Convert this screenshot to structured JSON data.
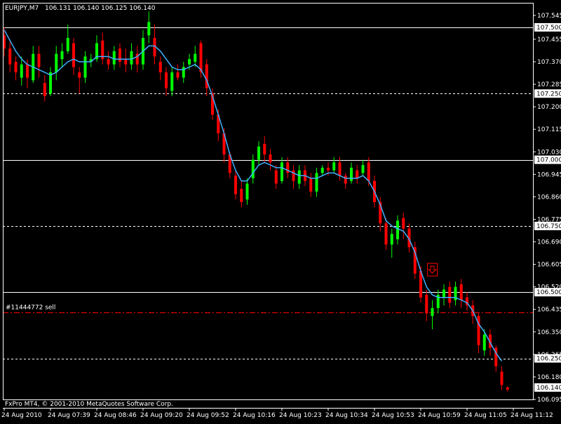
{
  "header": {
    "symbol": "EURJPY,M7",
    "quote": "106.131 106.140 106.125 106.140"
  },
  "footer": {
    "copyright": "FxPro MT4, © 2001-2010 MetaQuotes Software Corp."
  },
  "colors": {
    "background": "#000000",
    "frame": "#ffffff",
    "bull": "#00ff00",
    "bear": "#ff0000",
    "ma": "#3fb0ff",
    "order_line": "#ff0000",
    "text": "#ffffff",
    "bid_box": "#ffffff"
  },
  "chart_data": {
    "type": "candlestick",
    "ylim": [
      106.095,
      107.59
    ],
    "price_ticks": [
      {
        "v": 107.545,
        "label": "107.545"
      },
      {
        "v": 107.455,
        "label": "107.455"
      },
      {
        "v": 107.37,
        "label": "107.370"
      },
      {
        "v": 107.285,
        "label": "107.285"
      },
      {
        "v": 107.2,
        "label": "107.200"
      },
      {
        "v": 107.115,
        "label": "107.115"
      },
      {
        "v": 107.03,
        "label": "107.030"
      },
      {
        "v": 106.945,
        "label": "106.945"
      },
      {
        "v": 106.86,
        "label": "106.860"
      },
      {
        "v": 106.775,
        "label": "106.775"
      },
      {
        "v": 106.69,
        "label": "106.690"
      },
      {
        "v": 106.605,
        "label": "106.605"
      },
      {
        "v": 106.52,
        "label": "106.520"
      },
      {
        "v": 106.435,
        "label": "106.435"
      },
      {
        "v": 106.35,
        "label": "106.350"
      },
      {
        "v": 106.265,
        "label": "106.265"
      },
      {
        "v": 106.18,
        "label": "106.180"
      },
      {
        "v": 106.095,
        "label": "106.095"
      }
    ],
    "levels": [
      {
        "v": 107.5,
        "label": "107.500",
        "style": "solid"
      },
      {
        "v": 107.25,
        "label": "107.250",
        "style": "dashed"
      },
      {
        "v": 107.0,
        "label": "107.000",
        "style": "solid"
      },
      {
        "v": 106.75,
        "label": "106.750",
        "style": "dashed"
      },
      {
        "v": 106.5,
        "label": "106.500",
        "style": "solid"
      },
      {
        "v": 106.25,
        "label": "106.250",
        "style": "dashed"
      }
    ],
    "bid": {
      "v": 106.14,
      "label": "106.140"
    },
    "order": {
      "v": 106.425,
      "label": "#11444772 sell"
    },
    "sell_arrow": {
      "bar": 74,
      "v": 106.585
    },
    "time_labels": [
      {
        "bar": 0,
        "label": "24 Aug 2010"
      },
      {
        "bar": 8,
        "label": "24 Aug 07:39"
      },
      {
        "bar": 16,
        "label": "24 Aug 08:46"
      },
      {
        "bar": 24,
        "label": "24 Aug 09:20"
      },
      {
        "bar": 32,
        "label": "24 Aug 09:52"
      },
      {
        "bar": 40,
        "label": "24 Aug 10:16"
      },
      {
        "bar": 48,
        "label": "24 Aug 10:23"
      },
      {
        "bar": 56,
        "label": "24 Aug 10:34"
      },
      {
        "bar": 64,
        "label": "24 Aug 10:53"
      },
      {
        "bar": 72,
        "label": "24 Aug 10:59"
      },
      {
        "bar": 80,
        "label": "24 Aug 11:05"
      },
      {
        "bar": 88,
        "label": "24 Aug 11:12"
      }
    ],
    "candles": [
      [
        107.47,
        107.42,
        107.5,
        107.39
      ],
      [
        107.42,
        107.36,
        107.45,
        107.33
      ],
      [
        107.37,
        107.33,
        107.39,
        107.3
      ],
      [
        107.31,
        107.36,
        107.39,
        107.28
      ],
      [
        107.36,
        107.31,
        107.38,
        107.27
      ],
      [
        107.3,
        107.4,
        107.43,
        107.29
      ],
      [
        107.4,
        107.35,
        107.43,
        107.31
      ],
      [
        107.29,
        107.24,
        107.32,
        107.22
      ],
      [
        107.25,
        107.33,
        107.35,
        107.24
      ],
      [
        107.33,
        107.4,
        107.43,
        107.3
      ],
      [
        107.38,
        107.41,
        107.44,
        107.35
      ],
      [
        107.41,
        107.46,
        107.51,
        107.4
      ],
      [
        107.44,
        107.35,
        107.46,
        107.32
      ],
      [
        107.33,
        107.31,
        107.35,
        107.25
      ],
      [
        107.31,
        107.39,
        107.41,
        107.29
      ],
      [
        107.37,
        107.38,
        107.4,
        107.35
      ],
      [
        107.38,
        107.44,
        107.47,
        107.37
      ],
      [
        107.45,
        107.38,
        107.48,
        107.36
      ],
      [
        107.38,
        107.36,
        107.41,
        107.34
      ],
      [
        107.36,
        107.41,
        107.43,
        107.34
      ],
      [
        107.42,
        107.37,
        107.44,
        107.35
      ],
      [
        107.38,
        107.36,
        107.42,
        107.33
      ],
      [
        107.36,
        107.41,
        107.44,
        107.34
      ],
      [
        107.4,
        107.36,
        107.43,
        107.33
      ],
      [
        107.36,
        107.46,
        107.49,
        107.34
      ],
      [
        107.47,
        107.52,
        107.56,
        107.44
      ],
      [
        107.46,
        107.39,
        107.51,
        107.36
      ],
      [
        107.37,
        107.33,
        107.39,
        107.3
      ],
      [
        107.33,
        107.27,
        107.35,
        107.24
      ],
      [
        107.26,
        107.33,
        107.35,
        107.24
      ],
      [
        107.33,
        107.31,
        107.36,
        107.3
      ],
      [
        107.31,
        107.35,
        107.37,
        107.29
      ],
      [
        107.36,
        107.38,
        107.4,
        107.34
      ],
      [
        107.37,
        107.4,
        107.43,
        107.35
      ],
      [
        107.44,
        107.33,
        107.45,
        107.31
      ],
      [
        107.36,
        107.27,
        107.38,
        107.24
      ],
      [
        107.25,
        107.17,
        107.27,
        107.15
      ],
      [
        107.17,
        107.1,
        107.19,
        107.07
      ],
      [
        107.1,
        107.02,
        107.12,
        106.99
      ],
      [
        107.02,
        106.95,
        107.03,
        106.93
      ],
      [
        106.94,
        106.87,
        106.96,
        106.85
      ],
      [
        106.89,
        106.84,
        106.92,
        106.82
      ],
      [
        106.85,
        106.91,
        106.93,
        106.83
      ],
      [
        106.93,
        107.0,
        107.02,
        106.91
      ],
      [
        107.0,
        107.05,
        107.07,
        106.98
      ],
      [
        107.06,
        107.02,
        107.09,
        106.99
      ],
      [
        107.02,
        106.99,
        107.04,
        106.96
      ],
      [
        106.96,
        106.91,
        106.98,
        106.89
      ],
      [
        106.92,
        106.99,
        107.01,
        106.91
      ],
      [
        106.99,
        106.95,
        107.01,
        106.93
      ],
      [
        106.96,
        106.92,
        106.98,
        106.89
      ],
      [
        106.91,
        106.96,
        106.98,
        106.89
      ],
      [
        106.96,
        106.92,
        106.98,
        106.9
      ],
      [
        106.93,
        106.88,
        106.95,
        106.86
      ],
      [
        106.88,
        106.95,
        106.97,
        106.86
      ],
      [
        106.95,
        106.97,
        106.98,
        106.94
      ],
      [
        106.97,
        106.96,
        106.99,
        106.94
      ],
      [
        106.96,
        106.99,
        107.01,
        106.95
      ],
      [
        106.99,
        106.94,
        107.01,
        106.92
      ],
      [
        106.94,
        106.91,
        106.95,
        106.89
      ],
      [
        106.92,
        106.97,
        106.99,
        106.91
      ],
      [
        106.96,
        106.93,
        106.98,
        106.91
      ],
      [
        106.95,
        106.98,
        107.0,
        106.94
      ],
      [
        106.99,
        106.92,
        107.01,
        106.9
      ],
      [
        106.92,
        106.84,
        106.94,
        106.82
      ],
      [
        106.84,
        106.76,
        106.86,
        106.73
      ],
      [
        106.76,
        106.68,
        106.78,
        106.66
      ],
      [
        106.68,
        106.72,
        106.74,
        106.63
      ],
      [
        106.7,
        106.77,
        106.79,
        106.68
      ],
      [
        106.78,
        106.74,
        106.8,
        106.7
      ],
      [
        106.74,
        106.67,
        106.76,
        106.65
      ],
      [
        106.67,
        106.57,
        106.69,
        106.55
      ],
      [
        106.58,
        106.48,
        106.6,
        106.46
      ],
      [
        106.49,
        106.42,
        106.51,
        106.39
      ],
      [
        106.41,
        106.44,
        106.47,
        106.36
      ],
      [
        106.44,
        106.49,
        106.51,
        106.42
      ],
      [
        106.48,
        106.51,
        106.53,
        106.45
      ],
      [
        106.52,
        106.46,
        106.54,
        106.44
      ],
      [
        106.47,
        106.52,
        106.54,
        106.45
      ],
      [
        106.53,
        106.47,
        106.55,
        106.44
      ],
      [
        106.48,
        106.45,
        106.5,
        106.43
      ],
      [
        106.45,
        106.41,
        106.47,
        106.38
      ],
      [
        106.41,
        106.3,
        106.42,
        106.27
      ],
      [
        106.28,
        106.34,
        106.36,
        106.26
      ],
      [
        106.34,
        106.29,
        106.36,
        106.26
      ],
      [
        106.29,
        106.22,
        106.3,
        106.2
      ],
      [
        106.2,
        106.15,
        106.22,
        106.13
      ],
      [
        106.14,
        106.132,
        106.145,
        106.125
      ]
    ],
    "ma": [
      107.49,
      107.45,
      107.41,
      107.38,
      107.36,
      107.35,
      107.34,
      107.33,
      107.32,
      107.33,
      107.35,
      107.37,
      107.38,
      107.37,
      107.37,
      107.37,
      107.39,
      107.39,
      107.39,
      107.38,
      107.38,
      107.38,
      107.38,
      107.39,
      107.41,
      107.43,
      107.43,
      107.41,
      107.38,
      107.35,
      107.34,
      107.34,
      107.35,
      107.36,
      107.34,
      107.3,
      107.24,
      107.17,
      107.1,
      107.02,
      106.96,
      106.92,
      106.92,
      106.95,
      106.98,
      106.99,
      106.98,
      106.97,
      106.97,
      106.96,
      106.95,
      106.94,
      106.94,
      106.93,
      106.93,
      106.94,
      106.95,
      106.95,
      106.94,
      106.93,
      106.93,
      106.93,
      106.94,
      106.92,
      106.88,
      106.83,
      106.77,
      106.75,
      106.74,
      106.73,
      106.7,
      106.65,
      106.58,
      106.52,
      106.49,
      106.48,
      106.48,
      106.48,
      106.48,
      106.47,
      106.46,
      106.43,
      106.38,
      106.35,
      106.31,
      106.27,
      106.24
    ]
  }
}
